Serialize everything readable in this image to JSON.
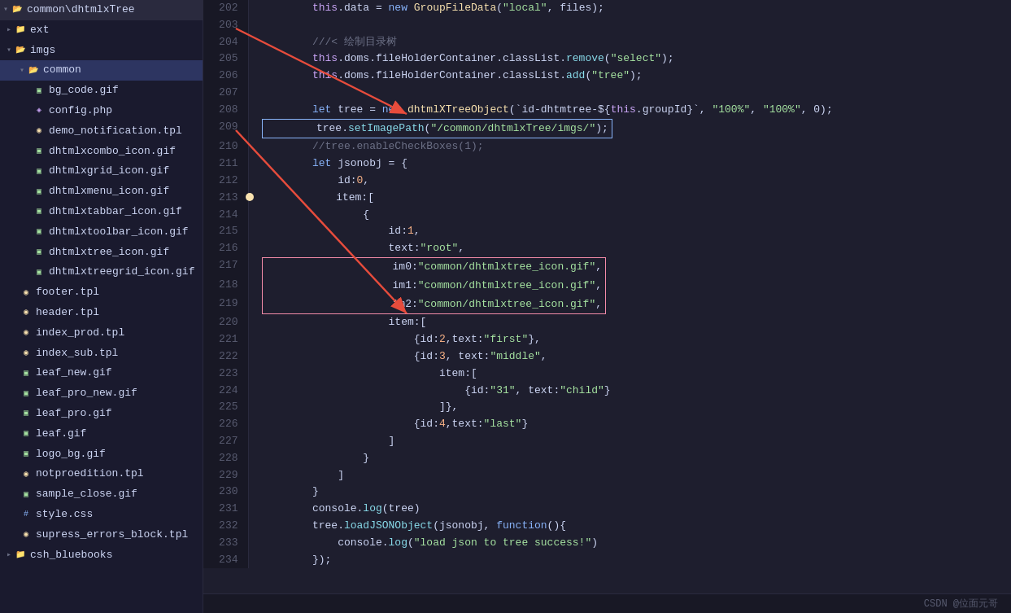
{
  "sidebar": {
    "items": [
      {
        "label": "common\\dhtmlxTree",
        "type": "folder-open",
        "indent": 0,
        "open": true
      },
      {
        "label": "ext",
        "type": "folder",
        "indent": 1,
        "open": false
      },
      {
        "label": "imgs",
        "type": "folder-open",
        "indent": 1,
        "open": true
      },
      {
        "label": "common",
        "type": "folder-open",
        "indent": 2,
        "open": true,
        "selected": true
      },
      {
        "label": "bg_code.gif",
        "type": "gif",
        "indent": 3
      },
      {
        "label": "config.php",
        "type": "php",
        "indent": 3
      },
      {
        "label": "demo_notification.tpl",
        "type": "tpl",
        "indent": 3
      },
      {
        "label": "dhtmlxcombo_icon.gif",
        "type": "gif",
        "indent": 3
      },
      {
        "label": "dhtmlxgrid_icon.gif",
        "type": "gif",
        "indent": 3
      },
      {
        "label": "dhtmlxmenu_icon.gif",
        "type": "gif",
        "indent": 3
      },
      {
        "label": "dhtmlxtabbar_icon.gif",
        "type": "gif",
        "indent": 3
      },
      {
        "label": "dhtmlxtoolbar_icon.gif",
        "type": "gif",
        "indent": 3
      },
      {
        "label": "dhtmlxtree_icon.gif",
        "type": "gif",
        "indent": 3
      },
      {
        "label": "dhtmlxtreegrid_icon.gif",
        "type": "gif",
        "indent": 3
      },
      {
        "label": "footer.tpl",
        "type": "tpl",
        "indent": 2
      },
      {
        "label": "header.tpl",
        "type": "tpl",
        "indent": 2
      },
      {
        "label": "index_prod.tpl",
        "type": "tpl",
        "indent": 2
      },
      {
        "label": "index_sub.tpl",
        "type": "tpl",
        "indent": 2
      },
      {
        "label": "leaf_new.gif",
        "type": "gif",
        "indent": 2
      },
      {
        "label": "leaf_pro_new.gif",
        "type": "gif",
        "indent": 2
      },
      {
        "label": "leaf_pro.gif",
        "type": "gif",
        "indent": 2
      },
      {
        "label": "leaf.gif",
        "type": "gif",
        "indent": 2
      },
      {
        "label": "logo_bg.gif",
        "type": "gif",
        "indent": 2
      },
      {
        "label": "notproedition.tpl",
        "type": "tpl",
        "indent": 2
      },
      {
        "label": "sample_close.gif",
        "type": "gif",
        "indent": 2
      },
      {
        "label": "style.css",
        "type": "css",
        "indent": 2
      },
      {
        "label": "supress_errors_block.tpl",
        "type": "tpl",
        "indent": 2
      },
      {
        "label": "csh_bluebooks",
        "type": "folder",
        "indent": 1,
        "open": false
      }
    ]
  },
  "code": {
    "lines": [
      {
        "num": 202,
        "tokens": [
          {
            "t": "        ",
            "c": "white"
          },
          {
            "t": "this",
            "c": "purple"
          },
          {
            "t": ".data = ",
            "c": "white"
          },
          {
            "t": "new ",
            "c": "blue"
          },
          {
            "t": "GroupFileData",
            "c": "yellow"
          },
          {
            "t": "(",
            "c": "white"
          },
          {
            "t": "\"local\"",
            "c": "green"
          },
          {
            "t": ", files);",
            "c": "white"
          }
        ]
      },
      {
        "num": 203,
        "tokens": []
      },
      {
        "num": 204,
        "tokens": [
          {
            "t": "        ",
            "c": "white"
          },
          {
            "t": "///< 绘制目录树",
            "c": "gray"
          }
        ]
      },
      {
        "num": 205,
        "tokens": [
          {
            "t": "        ",
            "c": "white"
          },
          {
            "t": "this",
            "c": "purple"
          },
          {
            "t": ".doms.fileHolderContainer.classList.",
            "c": "white"
          },
          {
            "t": "remove",
            "c": "cyan"
          },
          {
            "t": "(",
            "c": "white"
          },
          {
            "t": "\"select\"",
            "c": "green"
          },
          {
            "t": ");",
            "c": "white"
          }
        ]
      },
      {
        "num": 206,
        "tokens": [
          {
            "t": "        ",
            "c": "white"
          },
          {
            "t": "this",
            "c": "purple"
          },
          {
            "t": ".doms.fileHolderContainer.classList.",
            "c": "white"
          },
          {
            "t": "add",
            "c": "cyan"
          },
          {
            "t": "(",
            "c": "white"
          },
          {
            "t": "\"tree\"",
            "c": "green"
          },
          {
            "t": ");",
            "c": "white"
          }
        ]
      },
      {
        "num": 207,
        "tokens": []
      },
      {
        "num": 208,
        "tokens": [
          {
            "t": "        ",
            "c": "white"
          },
          {
            "t": "let ",
            "c": "blue"
          },
          {
            "t": "tree = ",
            "c": "white"
          },
          {
            "t": "new ",
            "c": "blue"
          },
          {
            "t": "dhtmlXTreeObject",
            "c": "yellow"
          },
          {
            "t": "(`id-dhtmtree-${",
            "c": "white"
          },
          {
            "t": "this",
            "c": "purple"
          },
          {
            "t": ".groupId}`, ",
            "c": "white"
          },
          {
            "t": "\"100%\"",
            "c": "green"
          },
          {
            "t": ", ",
            "c": "white"
          },
          {
            "t": "\"100%\"",
            "c": "green"
          },
          {
            "t": ", 0);",
            "c": "white"
          }
        ]
      },
      {
        "num": 209,
        "tokens": [
          {
            "t": "        ",
            "c": "white"
          },
          {
            "t": "tree.",
            "c": "white"
          },
          {
            "t": "setImagePath",
            "c": "cyan"
          },
          {
            "t": "(",
            "c": "white"
          },
          {
            "t": "\"/common/dhtmlxTree/imgs/\"",
            "c": "green"
          },
          {
            "t": ");",
            "c": "white"
          }
        ],
        "boxed": true
      },
      {
        "num": 210,
        "tokens": [
          {
            "t": "        ",
            "c": "white"
          },
          {
            "t": "//tree.enableCheckBoxes(1);",
            "c": "gray"
          }
        ]
      },
      {
        "num": 211,
        "tokens": [
          {
            "t": "        ",
            "c": "white"
          },
          {
            "t": "let ",
            "c": "blue"
          },
          {
            "t": "jsonobj = {",
            "c": "white"
          }
        ]
      },
      {
        "num": 212,
        "tokens": [
          {
            "t": "            ",
            "c": "white"
          },
          {
            "t": "id:",
            "c": "white"
          },
          {
            "t": "0",
            "c": "orange"
          },
          {
            "t": ",",
            "c": "white"
          }
        ]
      },
      {
        "num": 213,
        "tokens": [
          {
            "t": "            ",
            "c": "white"
          },
          {
            "t": "item:[",
            "c": "white"
          }
        ],
        "dotted": true
      },
      {
        "num": 214,
        "tokens": [
          {
            "t": "                ",
            "c": "white"
          },
          {
            "t": "{",
            "c": "white"
          }
        ]
      },
      {
        "num": 215,
        "tokens": [
          {
            "t": "                    ",
            "c": "white"
          },
          {
            "t": "id:",
            "c": "white"
          },
          {
            "t": "1",
            "c": "orange"
          },
          {
            "t": ",",
            "c": "white"
          }
        ]
      },
      {
        "num": 216,
        "tokens": [
          {
            "t": "                    ",
            "c": "white"
          },
          {
            "t": "text:",
            "c": "white"
          },
          {
            "t": "\"root\"",
            "c": "green"
          },
          {
            "t": ",",
            "c": "white"
          }
        ]
      },
      {
        "num": 217,
        "tokens": [
          {
            "t": "                    ",
            "c": "white"
          },
          {
            "t": "im0:",
            "c": "white"
          },
          {
            "t": "\"common/dhtmlxtree_icon.gif\"",
            "c": "green"
          },
          {
            "t": ",",
            "c": "white"
          }
        ],
        "boxed_red": true
      },
      {
        "num": 218,
        "tokens": [
          {
            "t": "                    ",
            "c": "white"
          },
          {
            "t": "im1:",
            "c": "white"
          },
          {
            "t": "\"common/dhtmlxtree_icon.gif\"",
            "c": "green"
          },
          {
            "t": ",",
            "c": "white"
          }
        ],
        "boxed_red": true
      },
      {
        "num": 219,
        "tokens": [
          {
            "t": "                    ",
            "c": "white"
          },
          {
            "t": "im2:",
            "c": "white"
          },
          {
            "t": "\"common/dhtmlxtree_icon.gif\"",
            "c": "green"
          },
          {
            "t": ",",
            "c": "white"
          }
        ],
        "boxed_red": true
      },
      {
        "num": 220,
        "tokens": [
          {
            "t": "                    ",
            "c": "white"
          },
          {
            "t": "item:[",
            "c": "white"
          }
        ]
      },
      {
        "num": 221,
        "tokens": [
          {
            "t": "                        ",
            "c": "white"
          },
          {
            "t": "{id:",
            "c": "white"
          },
          {
            "t": "2",
            "c": "orange"
          },
          {
            "t": ",text:",
            "c": "white"
          },
          {
            "t": "\"first\"",
            "c": "green"
          },
          {
            "t": "},",
            "c": "white"
          }
        ]
      },
      {
        "num": 222,
        "tokens": [
          {
            "t": "                        ",
            "c": "white"
          },
          {
            "t": "{id:",
            "c": "white"
          },
          {
            "t": "3",
            "c": "orange"
          },
          {
            "t": ", text:",
            "c": "white"
          },
          {
            "t": "\"middle\"",
            "c": "green"
          },
          {
            "t": ",",
            "c": "white"
          }
        ]
      },
      {
        "num": 223,
        "tokens": [
          {
            "t": "                            ",
            "c": "white"
          },
          {
            "t": "item:[",
            "c": "white"
          }
        ]
      },
      {
        "num": 224,
        "tokens": [
          {
            "t": "                                ",
            "c": "white"
          },
          {
            "t": "{id:",
            "c": "white"
          },
          {
            "t": "\"31\"",
            "c": "green"
          },
          {
            "t": ", text:",
            "c": "white"
          },
          {
            "t": "\"child\"",
            "c": "green"
          },
          {
            "t": "}",
            "c": "white"
          }
        ]
      },
      {
        "num": 225,
        "tokens": [
          {
            "t": "                            ",
            "c": "white"
          },
          {
            "t": "]},",
            "c": "white"
          }
        ]
      },
      {
        "num": 226,
        "tokens": [
          {
            "t": "                        ",
            "c": "white"
          },
          {
            "t": "{id:",
            "c": "white"
          },
          {
            "t": "4",
            "c": "orange"
          },
          {
            "t": ",text:",
            "c": "white"
          },
          {
            "t": "\"last\"",
            "c": "green"
          },
          {
            "t": "}",
            "c": "white"
          }
        ]
      },
      {
        "num": 227,
        "tokens": [
          {
            "t": "                    ",
            "c": "white"
          },
          {
            "t": "]",
            "c": "white"
          }
        ]
      },
      {
        "num": 228,
        "tokens": [
          {
            "t": "                ",
            "c": "white"
          },
          {
            "t": "}",
            "c": "white"
          }
        ]
      },
      {
        "num": 229,
        "tokens": [
          {
            "t": "            ",
            "c": "white"
          },
          {
            "t": "]",
            "c": "white"
          }
        ]
      },
      {
        "num": 230,
        "tokens": [
          {
            "t": "        ",
            "c": "white"
          },
          {
            "t": "}",
            "c": "white"
          }
        ]
      },
      {
        "num": 231,
        "tokens": [
          {
            "t": "        ",
            "c": "white"
          },
          {
            "t": "console.",
            "c": "white"
          },
          {
            "t": "log",
            "c": "cyan"
          },
          {
            "t": "(tree)",
            "c": "white"
          }
        ]
      },
      {
        "num": 232,
        "tokens": [
          {
            "t": "        ",
            "c": "white"
          },
          {
            "t": "tree.",
            "c": "white"
          },
          {
            "t": "loadJSONObject",
            "c": "cyan"
          },
          {
            "t": "(jsonobj, ",
            "c": "white"
          },
          {
            "t": "function",
            "c": "blue"
          },
          {
            "t": "(){",
            "c": "white"
          }
        ]
      },
      {
        "num": 233,
        "tokens": [
          {
            "t": "            ",
            "c": "white"
          },
          {
            "t": "console.",
            "c": "white"
          },
          {
            "t": "log",
            "c": "cyan"
          },
          {
            "t": "(",
            "c": "white"
          },
          {
            "t": "\"load json to tree success!\"",
            "c": "green"
          },
          {
            "t": ")",
            "c": "white"
          }
        ]
      },
      {
        "num": 234,
        "tokens": [
          {
            "t": "        ",
            "c": "white"
          },
          {
            "t": "});",
            "c": "white"
          }
        ]
      }
    ]
  },
  "watermark": "CSDN @位面元哥"
}
